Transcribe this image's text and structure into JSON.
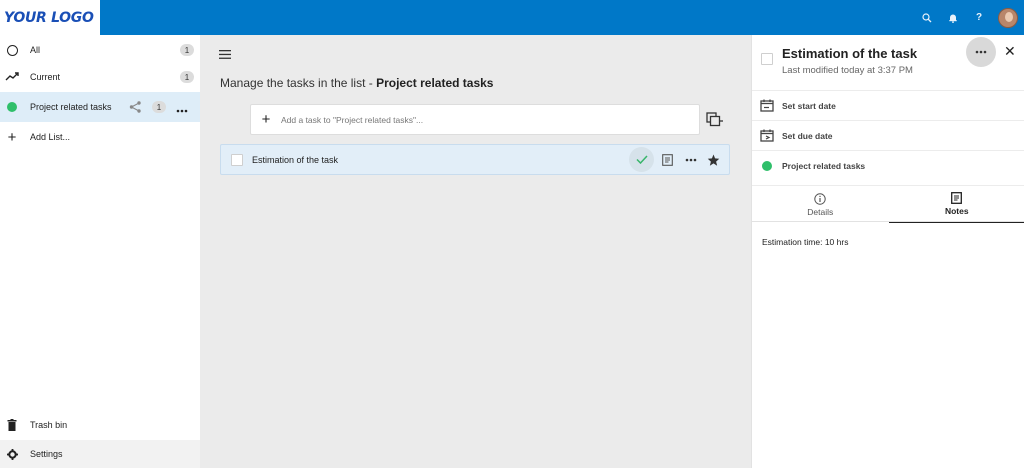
{
  "app": {
    "logo_text": "YOUR LOGO"
  },
  "topbar": {
    "icons": [
      "search-icon",
      "bell-icon",
      "help-icon",
      "avatar"
    ],
    "help_glyph": "?",
    "color": "#0078c8"
  },
  "sidebar": {
    "items": [
      {
        "label": "All",
        "count": "1",
        "icon": "circle-icon"
      },
      {
        "label": "Current",
        "count": "1",
        "icon": "trending-icon"
      },
      {
        "label": "Project related tasks",
        "count": "1",
        "icon": "green-dot-icon",
        "selected": true
      },
      {
        "label": "Add List...",
        "icon": "plus-icon"
      }
    ],
    "trash_label": "Trash bin",
    "settings_label": "Settings"
  },
  "main": {
    "title_prefix": "Manage the tasks in the list - ",
    "title_list": "Project related tasks",
    "add_placeholder": "Add a task to \"Project related tasks\"...",
    "tasks": [
      {
        "name": "Estimation of the task",
        "starred": true
      }
    ]
  },
  "panel": {
    "title": "Estimation of the task",
    "subtitle": "Last modified today at 3:37 PM",
    "start_date_label": "Set start date",
    "due_date_label": "Set due date",
    "list_label": "Project related tasks",
    "tabs": [
      {
        "label": "Details"
      },
      {
        "label": "Notes",
        "active": true
      }
    ],
    "notes_text": "Estimation time: 10 hrs"
  },
  "colors": {
    "accent": "#0078c8",
    "list_green": "#2fbf6a",
    "selected_bg": "#deedf8"
  }
}
